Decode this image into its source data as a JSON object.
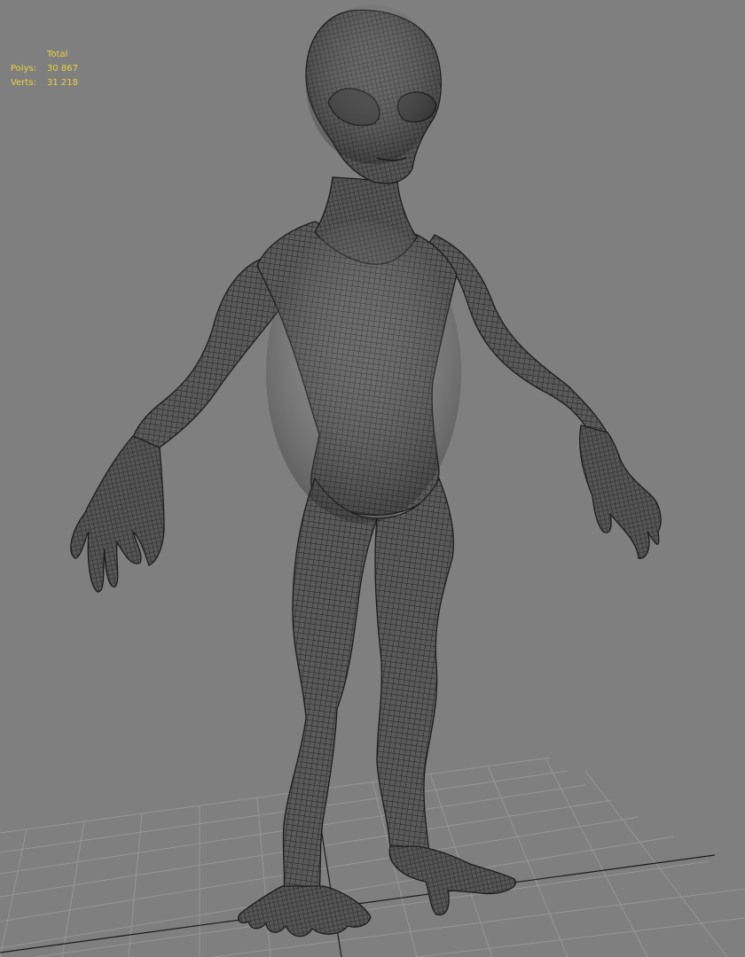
{
  "stats": {
    "header": "Total",
    "rows": [
      {
        "label": "Polys:",
        "value": "30 867"
      },
      {
        "label": "Verts:",
        "value": "31 218"
      }
    ]
  },
  "colors": {
    "background": "#7f7f7f",
    "stats_text": "#e8d23a",
    "grid_line": "#969696",
    "grid_axis": "#1a1a1a",
    "mesh_fill": "#5a5a5a",
    "wire": "#202020"
  }
}
